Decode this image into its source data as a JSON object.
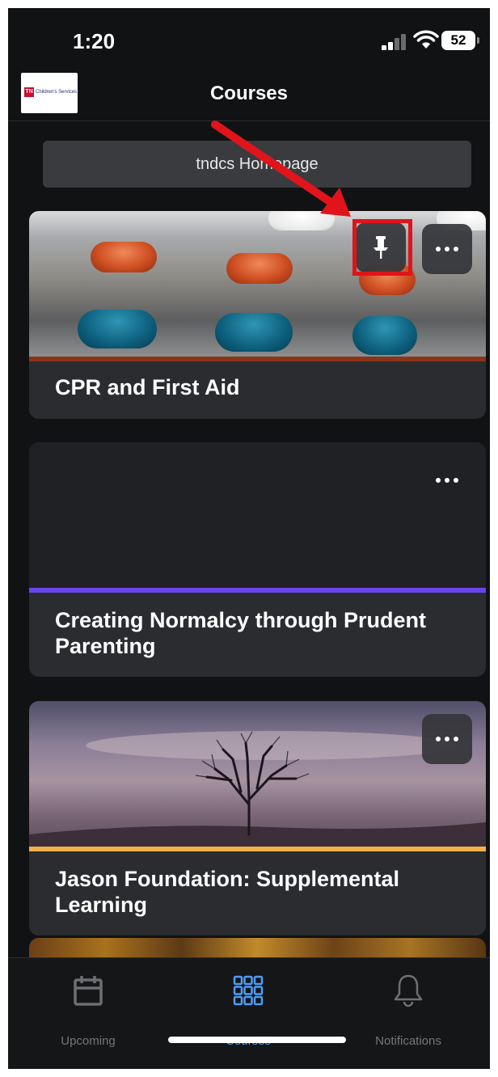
{
  "status": {
    "time": "1:20",
    "battery": "52"
  },
  "nav": {
    "title": "Courses"
  },
  "homepage_button": {
    "label": "tndcs Homepage"
  },
  "cards": [
    {
      "title": "CPR and First Aid",
      "stripe_color": "#8a3418"
    },
    {
      "title": "Creating Normalcy through Prudent Parenting",
      "stripe_color": "#6a44f0"
    },
    {
      "title": "Jason Foundation: Supplemental Learning",
      "stripe_color": "#f2b24a"
    }
  ],
  "tabs": [
    {
      "label": "Upcoming"
    },
    {
      "label": "Courses"
    },
    {
      "label": "Notifications"
    }
  ],
  "colors": {
    "accent": "#4e9cf5",
    "annotation": "#e0141a"
  }
}
